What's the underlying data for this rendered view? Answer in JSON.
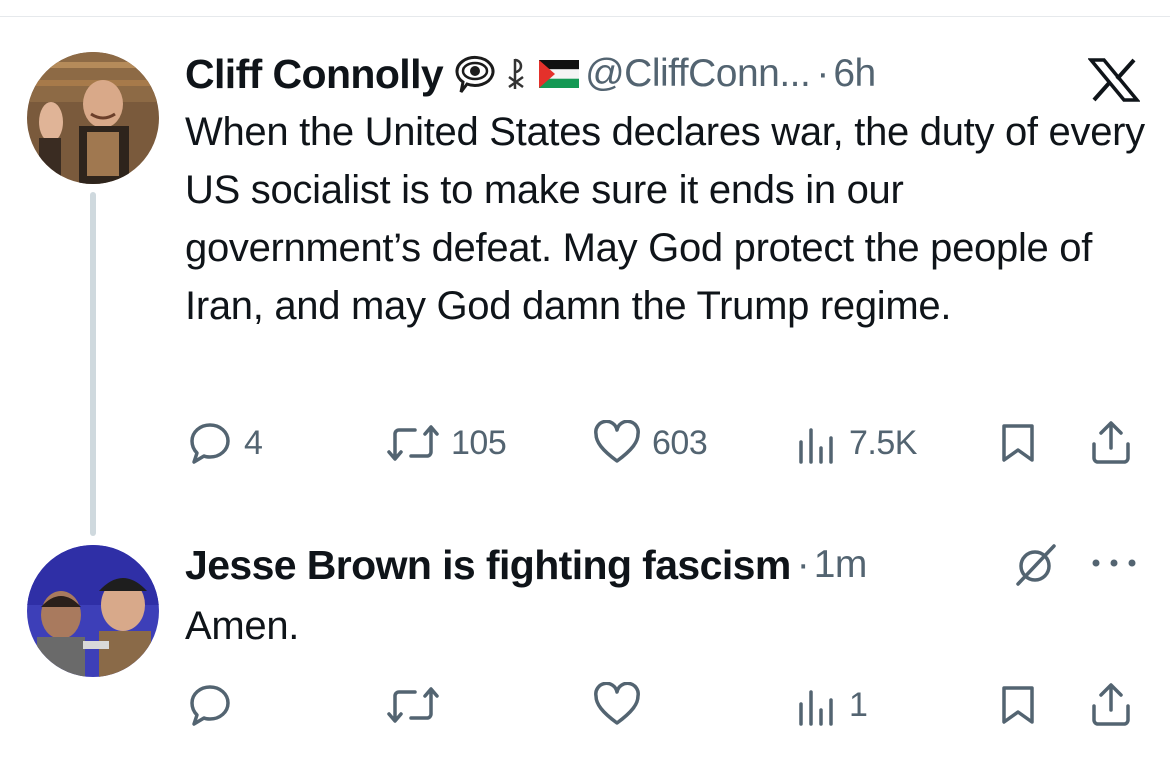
{
  "tweet": {
    "author": {
      "display_name": "Cliff Connolly",
      "handle": "@CliffConn...",
      "time": "6h",
      "badges": [
        "eye-in-speech-bubble-icon",
        "chi-rho-icon",
        "palestine-flag-icon"
      ]
    },
    "text": "When the United States declares war, the duty of every US socialist is to make sure it ends in our government’s defeat. May God protect the people of Iran, and may God damn the Trump regime.",
    "actions": {
      "replies": "4",
      "reposts": "105",
      "likes": "603",
      "views": "7.5K"
    },
    "platform_icon": "x-logo-icon"
  },
  "reply": {
    "author": {
      "display_name": "Jesse Brown is fighting fascism",
      "time": "1m"
    },
    "text": "Amen.",
    "actions": {
      "replies": "",
      "reposts": "",
      "likes": "",
      "views": "1"
    }
  },
  "colors": {
    "text_primary": "#0f1419",
    "text_secondary": "#536471",
    "thread_line": "#cfd9de"
  }
}
